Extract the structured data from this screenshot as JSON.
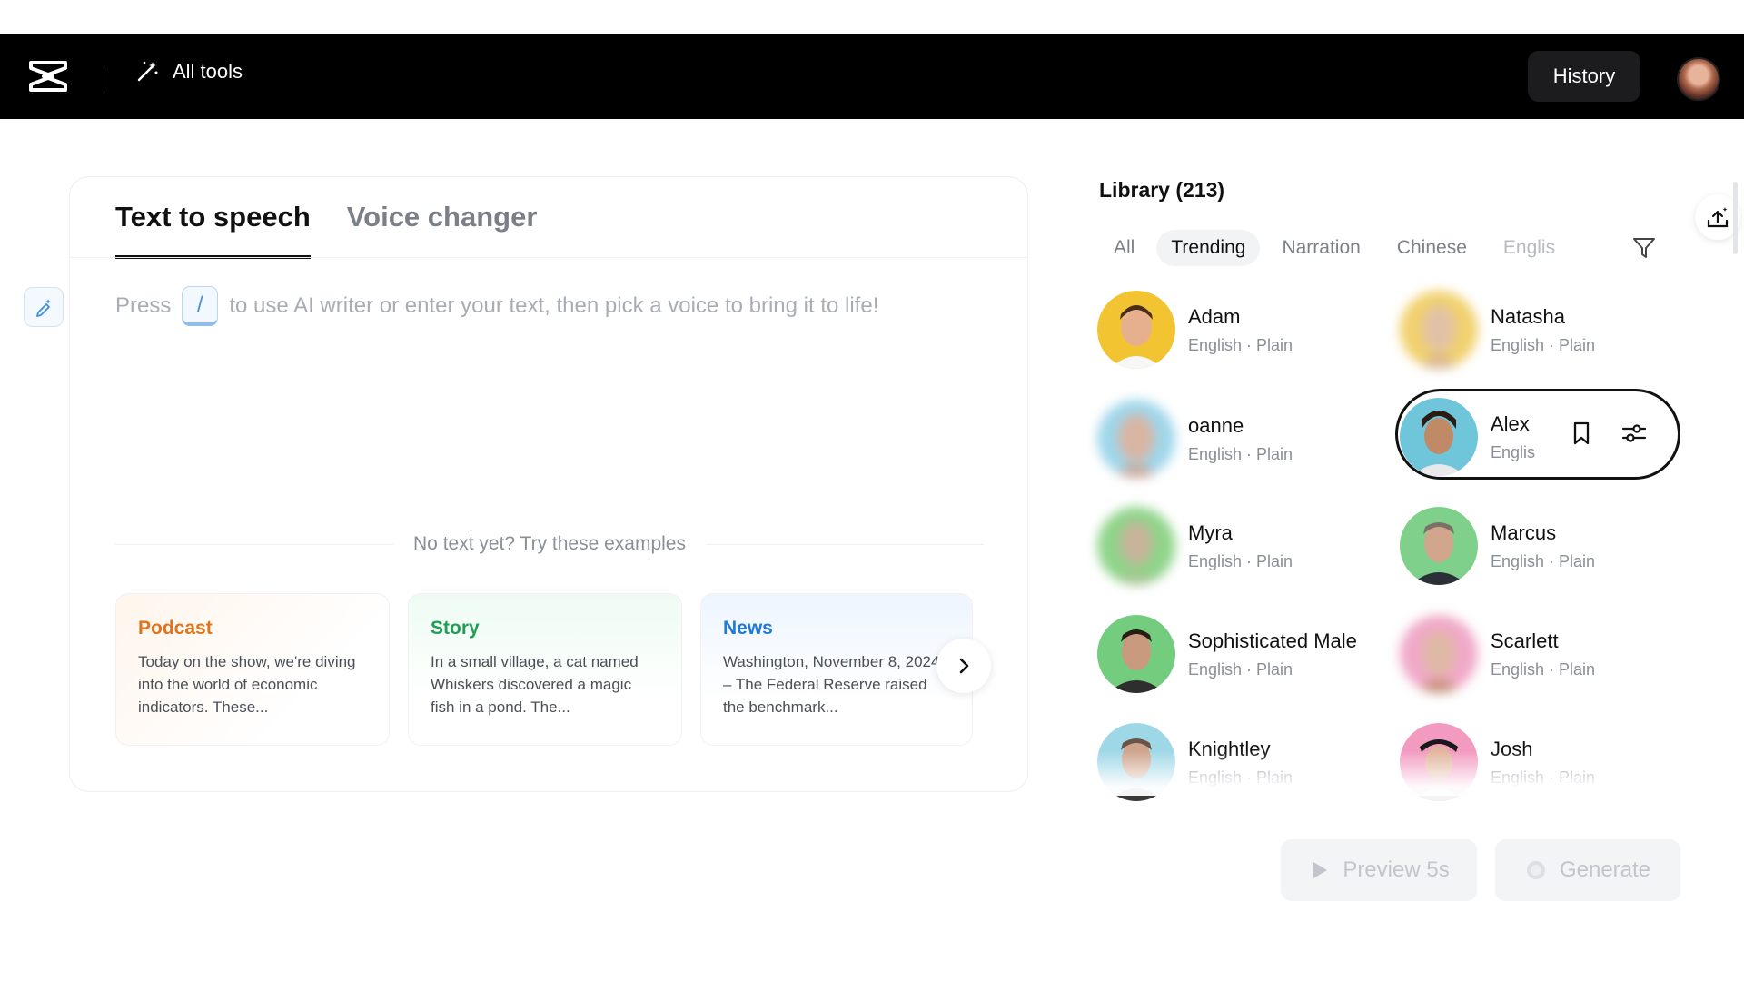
{
  "header": {
    "all_tools_label": "All tools",
    "history_label": "History"
  },
  "editor": {
    "tabs": [
      {
        "label": "Text to speech",
        "active": true
      },
      {
        "label": "Voice changer",
        "active": false
      }
    ],
    "hint_prefix": "Press",
    "hint_key": "/",
    "hint_suffix": "to use AI writer or enter your text, then pick a voice to bring it to life!",
    "examples_label": "No text yet? Try these examples",
    "examples": [
      {
        "title": "Podcast",
        "body": "Today on the show, we're diving into the world of economic indicators. These..."
      },
      {
        "title": "Story",
        "body": "In a small village, a cat named Whiskers discovered a magic fish in a pond. The..."
      },
      {
        "title": "News",
        "body": "Washington, November 8, 2024 – The Federal Reserve raised the benchmark..."
      }
    ]
  },
  "library": {
    "title": "Library (213)",
    "filters": [
      "All",
      "Trending",
      "Narration",
      "Chinese",
      "Englis"
    ],
    "active_filter": "Trending",
    "voices": [
      {
        "name": "Adam",
        "meta": "English · Plain"
      },
      {
        "name": "Natasha",
        "meta": "English · Plain"
      },
      {
        "name": "oanne",
        "meta": "English · Plain"
      },
      {
        "name": "Alex",
        "meta": "Englis"
      },
      {
        "name": "Myra",
        "meta": "English · Plain"
      },
      {
        "name": "Marcus",
        "meta": "English · Plain"
      },
      {
        "name": "Sophisticated Male",
        "meta": "English · Plain"
      },
      {
        "name": "Scarlett",
        "meta": "English · Plain"
      },
      {
        "name": "Knightley",
        "meta": "English · Plain"
      },
      {
        "name": "Josh",
        "meta": "English · Plain"
      }
    ]
  },
  "actions": {
    "preview_label": "Preview 5s",
    "generate_label": "Generate"
  },
  "colors": {
    "topbar": "#000000",
    "podcast": "#e0731c",
    "story": "#1f9e56",
    "news": "#2179d6",
    "disabled_text": "#c2c6cc"
  }
}
